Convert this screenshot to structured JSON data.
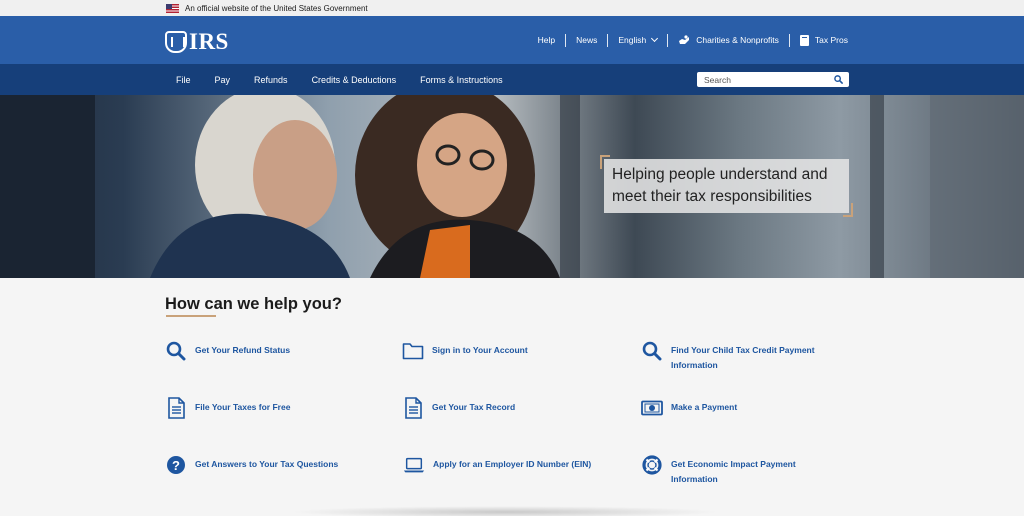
{
  "gov_banner": {
    "text": "An official website of the United States Government"
  },
  "header": {
    "logo": "IRS",
    "util_nav": {
      "help": "Help",
      "news": "News",
      "language": "English",
      "charities": "Charities & Nonprofits",
      "tax_pros": "Tax Pros"
    }
  },
  "nav": {
    "items": [
      "File",
      "Pay",
      "Refunds",
      "Credits & Deductions",
      "Forms & Instructions"
    ],
    "search_placeholder": "Search"
  },
  "hero": {
    "text": "Helping people understand and meet their tax responsibilities"
  },
  "help": {
    "heading": "How can we help you?",
    "links": [
      {
        "label": "Get Your Refund Status",
        "icon": "search-icon"
      },
      {
        "label": "Sign in to Your Account",
        "icon": "folder-icon"
      },
      {
        "label": "Find Your Child Tax Credit Payment Information",
        "icon": "search-icon"
      },
      {
        "label": "File Your Taxes for Free",
        "icon": "document-icon"
      },
      {
        "label": "Get Your Tax Record",
        "icon": "document-icon"
      },
      {
        "label": "Make a Payment",
        "icon": "money-icon"
      },
      {
        "label": "Get Answers to Your Tax Questions",
        "icon": "question-icon"
      },
      {
        "label": "Apply for an Employer ID Number (EIN)",
        "icon": "laptop-icon"
      },
      {
        "label": "Get Economic Impact Payment Information",
        "icon": "lifebuoy-icon"
      }
    ]
  },
  "colors": {
    "header_blue": "#2a5ea8",
    "nav_blue": "#163f7a",
    "link_blue": "#1e56a0",
    "accent_tan": "#c9a27a"
  }
}
